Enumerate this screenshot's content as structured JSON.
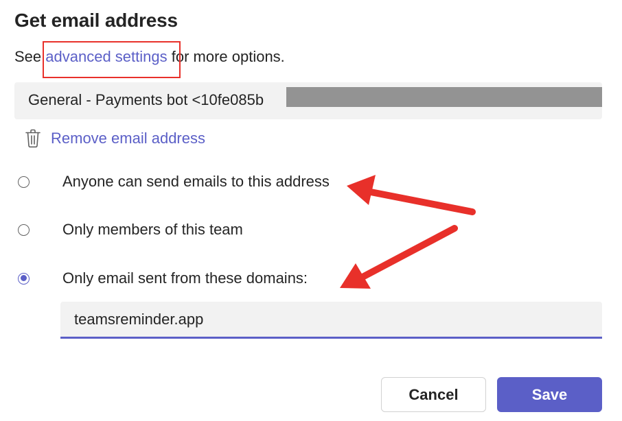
{
  "dialog": {
    "title": "Get email address",
    "subtitle_prefix": "See ",
    "subtitle_link": "advanced settings",
    "subtitle_suffix": " for more options."
  },
  "email": {
    "value": "General - Payments bot <10fe085b",
    "redacted": true
  },
  "remove": {
    "label": "Remove email address",
    "icon": "trash-icon"
  },
  "radio_options": [
    {
      "label": "Anyone can send emails to this address",
      "checked": false
    },
    {
      "label": "Only members of this team",
      "checked": false
    },
    {
      "label": "Only email sent from these domains:",
      "checked": true
    }
  ],
  "domains": {
    "value": "teamsreminder.app"
  },
  "buttons": {
    "cancel": "Cancel",
    "save": "Save"
  },
  "colors": {
    "accent": "#5b5fc7",
    "annotation": "#e8302a",
    "field_background": "#f2f2f2"
  }
}
